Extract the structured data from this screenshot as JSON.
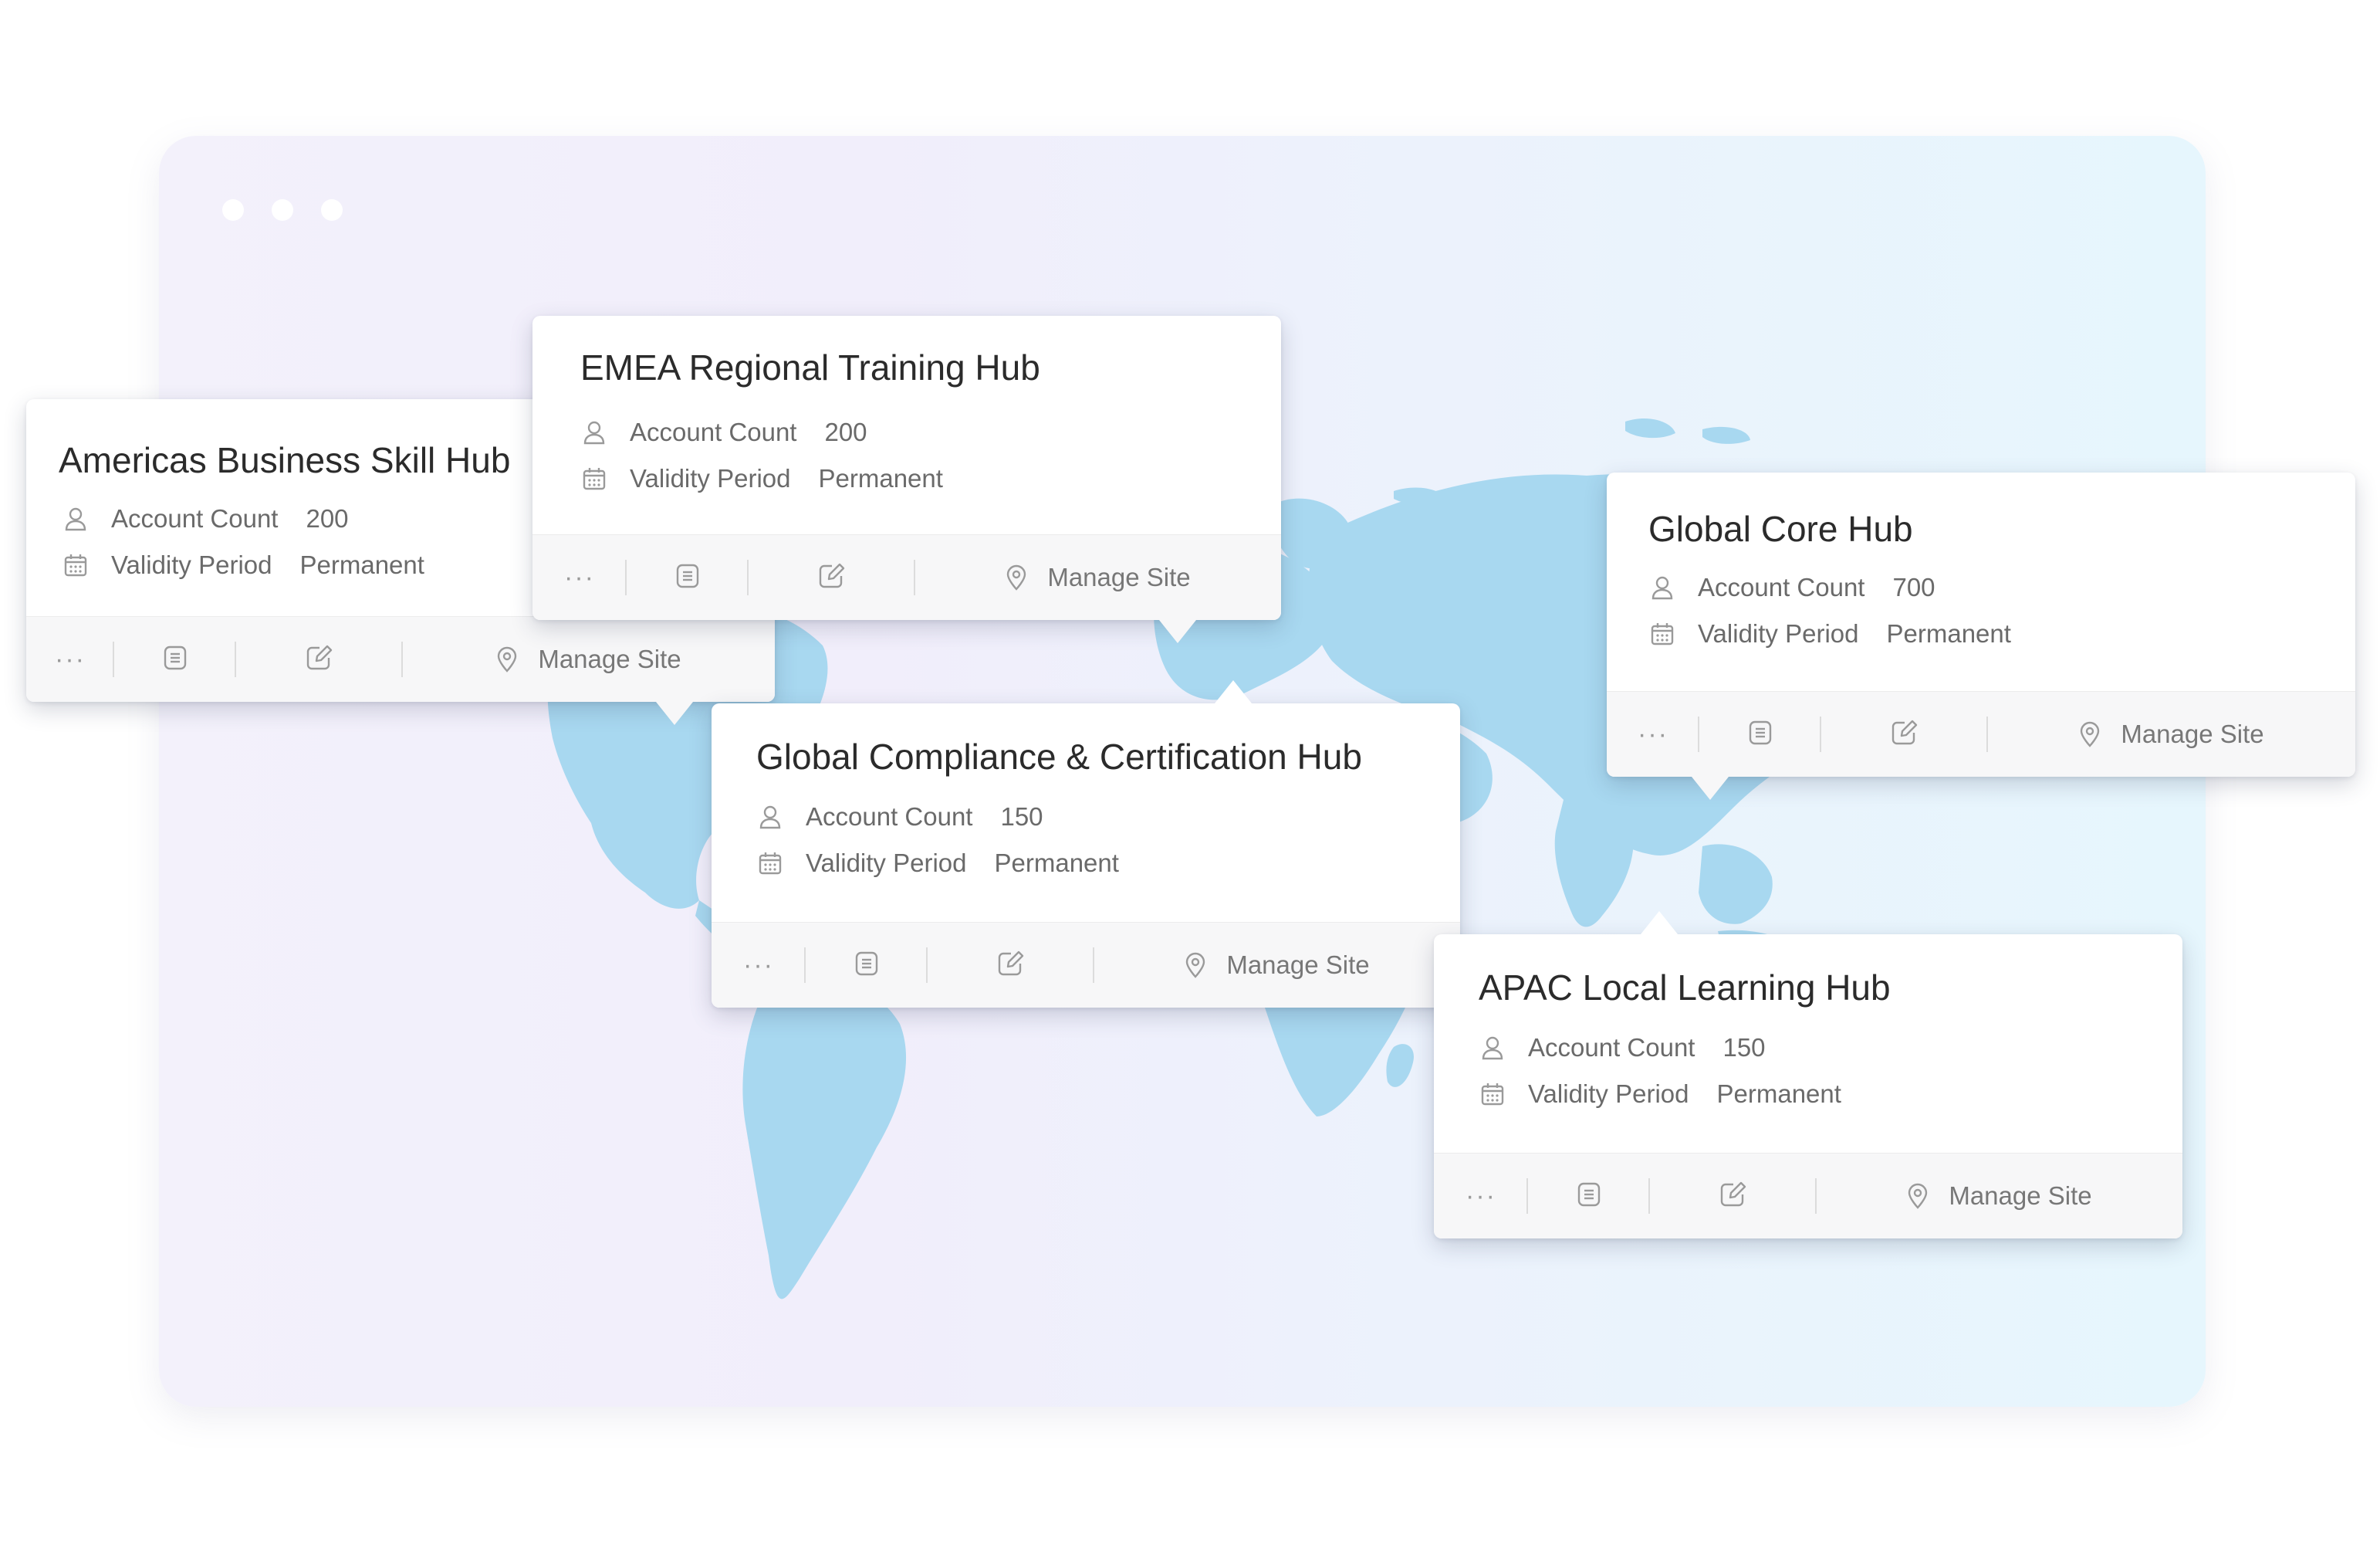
{
  "labels": {
    "account_count": "Account Count",
    "validity_period": "Validity Period",
    "manage_site": "Manage Site",
    "more": "···"
  },
  "icons": [
    "user-icon",
    "calendar-icon",
    "more-icon",
    "document-icon",
    "edit-icon",
    "location-pin-icon"
  ],
  "colors": {
    "map_land": "#a8d8f0",
    "text_dark": "#2b2b2b",
    "text_muted": "#6a6a6a"
  },
  "hubs": {
    "americas": {
      "title": "Americas Business Skill Hub",
      "account_count": "200",
      "validity_period": "Permanent"
    },
    "emea": {
      "title": "EMEA Regional Training Hub",
      "account_count": "200",
      "validity_period": "Permanent"
    },
    "global_core": {
      "title": "Global Core Hub",
      "account_count": "700",
      "validity_period": "Permanent"
    },
    "compliance": {
      "title": "Global Compliance & Certification Hub",
      "account_count": "150",
      "validity_period": "Permanent"
    },
    "apac": {
      "title": "APAC Local Learning Hub",
      "account_count": "150",
      "validity_period": "Permanent"
    }
  }
}
